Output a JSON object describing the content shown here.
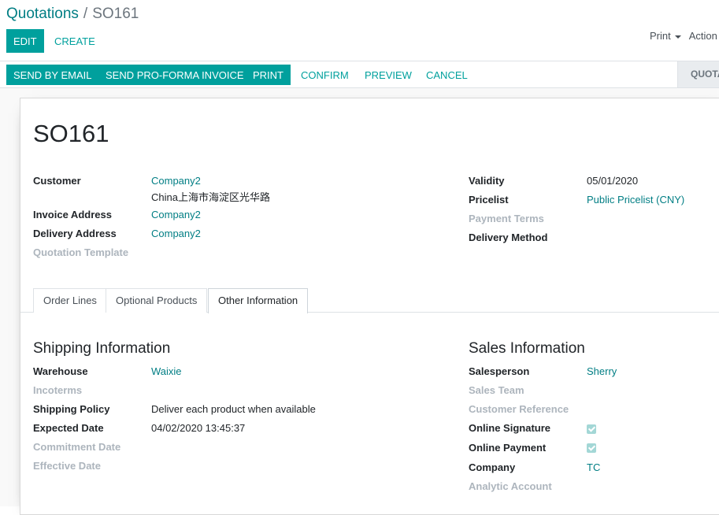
{
  "breadcrumb": {
    "parent": "Quotations",
    "separator": "/",
    "current": "SO161"
  },
  "control": {
    "edit_label": "EDIT",
    "create_label": "CREATE",
    "print_label": "Print",
    "action_label": "Action"
  },
  "statusbar": {
    "buttons": [
      "SEND BY EMAIL",
      "SEND PRO-FORMA INVOICE",
      "PRINT",
      "CONFIRM",
      "PREVIEW",
      "CANCEL"
    ],
    "stage": "QUOTATION"
  },
  "form": {
    "title": "SO161",
    "left_fields": {
      "customer_label": "Customer",
      "customer_value": "Company2",
      "customer_address": "China上海市海淀区光华路",
      "invoice_label": "Invoice Address",
      "invoice_value": "Company2",
      "delivery_label": "Delivery Address",
      "delivery_value": "Company2",
      "template_label": "Quotation Template"
    },
    "right_fields": {
      "validity_label": "Validity",
      "validity_value": "05/01/2020",
      "pricelist_label": "Pricelist",
      "pricelist_value": "Public Pricelist (CNY)",
      "payment_terms_label": "Payment Terms",
      "delivery_method_label": "Delivery Method"
    },
    "tabs": [
      "Order Lines",
      "Optional Products",
      "Other Information"
    ],
    "shipping": {
      "title": "Shipping Information",
      "warehouse_label": "Warehouse",
      "warehouse_value": "Waixie",
      "incoterms_label": "Incoterms",
      "policy_label": "Shipping Policy",
      "policy_value": "Deliver each product when available",
      "expected_label": "Expected Date",
      "expected_value": "04/02/2020 13:45:37",
      "commitment_label": "Commitment Date",
      "effective_label": "Effective Date"
    },
    "sales": {
      "title": "Sales Information",
      "salesperson_label": "Salesperson",
      "salesperson_value": "Sherry",
      "team_label": "Sales Team",
      "customer_ref_label": "Customer Reference",
      "online_signature_label": "Online Signature",
      "online_payment_label": "Online Payment",
      "company_label": "Company",
      "company_value": "TC",
      "analytic_label": "Analytic Account"
    }
  },
  "colors": {
    "primary": "#00a09d",
    "link": "#017e84",
    "muted": "#adb5bd"
  }
}
